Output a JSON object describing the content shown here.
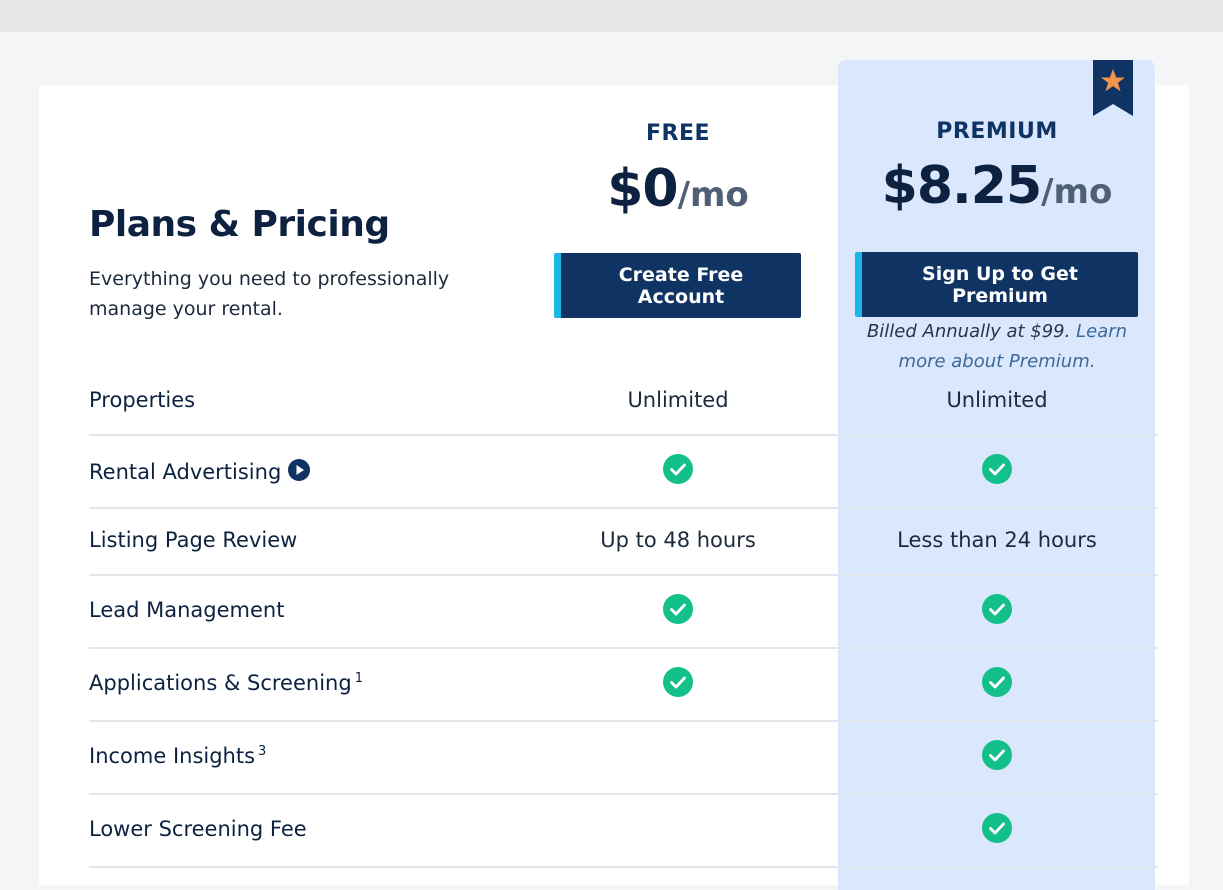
{
  "header": {
    "title": "Plans & Pricing",
    "subtitle": "Everything you need to professionally manage your rental."
  },
  "plans": {
    "free": {
      "name": "FREE",
      "price": "$0",
      "per": "/mo",
      "cta": "Create Free Account"
    },
    "premium": {
      "name": "PREMIUM",
      "price": "$8.25",
      "per": "/mo",
      "cta": "Sign Up to Get Premium",
      "billed_text": "Billed Annually at $99.",
      "learn_more": "Learn more about Premium."
    }
  },
  "features": [
    {
      "label": "Properties",
      "sup": "",
      "free": "Unlimited",
      "premium": "Unlimited"
    },
    {
      "label": "Rental Advertising",
      "sup": "",
      "free": "check",
      "premium": "check"
    },
    {
      "label": "Listing Page Review",
      "sup": "",
      "free": "Up to 48 hours",
      "premium": "Less than 24 hours"
    },
    {
      "label": "Lead Management",
      "sup": "",
      "free": "check",
      "premium": "check"
    },
    {
      "label": "Applications & Screening",
      "sup": "1",
      "free": "check",
      "premium": "check"
    },
    {
      "label": "Income Insights",
      "sup": "3",
      "free": "",
      "premium": "check"
    },
    {
      "label": "Lower Screening Fee",
      "sup": "",
      "free": "",
      "premium": "check"
    }
  ],
  "colors": {
    "navy": "#0f3463",
    "accent_bar": "#1bb6e8",
    "premium_bg": "#dbe7fd",
    "check": "#14c08a",
    "star": "#f5934a"
  },
  "icons": {
    "ribbon": "star-ribbon-icon",
    "play": "play-circle-icon",
    "check": "checkmark-circle-icon"
  }
}
